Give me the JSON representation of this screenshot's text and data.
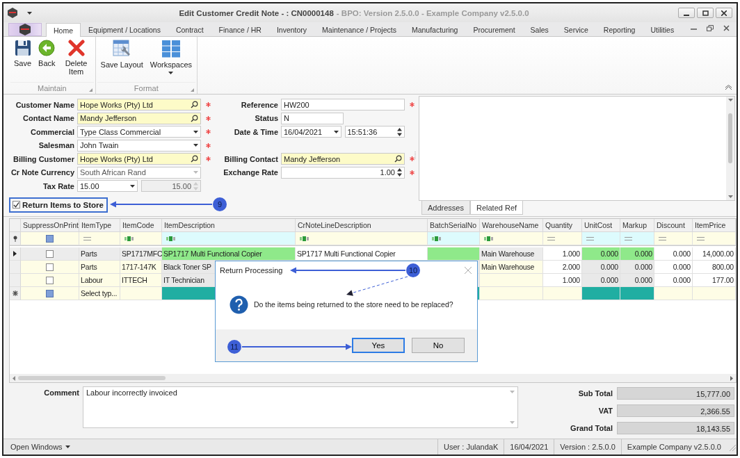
{
  "window": {
    "title": "Edit Customer Credit Note - : CN0000148",
    "subtitle": "- BPO: Version 2.5.0.0 - Example Company v2.5.0.0"
  },
  "ribbon": {
    "tabs": [
      {
        "label": "Home",
        "selected": true
      },
      {
        "label": "Equipment / Locations",
        "selected": false
      },
      {
        "label": "Contract",
        "selected": false
      },
      {
        "label": "Finance / HR",
        "selected": false
      },
      {
        "label": "Inventory",
        "selected": false
      },
      {
        "label": "Maintenance / Projects",
        "selected": false
      },
      {
        "label": "Manufacturing",
        "selected": false
      },
      {
        "label": "Procurement",
        "selected": false
      },
      {
        "label": "Sales",
        "selected": false
      },
      {
        "label": "Service",
        "selected": false
      },
      {
        "label": "Reporting",
        "selected": false
      },
      {
        "label": "Utilities",
        "selected": false
      }
    ],
    "groups": [
      {
        "label": "Maintain",
        "buttons": [
          {
            "label": "Save",
            "dropdown": false
          },
          {
            "label": "Back",
            "dropdown": false
          },
          {
            "label": "Delete Item",
            "dropdown": false
          }
        ]
      },
      {
        "label": "Format",
        "buttons": [
          {
            "label": "Save Layout",
            "dropdown": false
          },
          {
            "label": "Workspaces",
            "dropdown": true
          }
        ]
      }
    ]
  },
  "form": {
    "left": [
      {
        "label": "Customer Name",
        "required": true,
        "fields": [
          {
            "kind": "lookup",
            "value": "Hope Works (Pty) Ltd",
            "disabled": false
          }
        ]
      },
      {
        "label": "Contact Name",
        "required": true,
        "fields": [
          {
            "kind": "lookup",
            "value": "Mandy Jefferson",
            "disabled": false
          }
        ]
      },
      {
        "label": "Commercial",
        "required": true,
        "fields": [
          {
            "kind": "combo",
            "value": "Type Class Commercial",
            "disabled": false
          }
        ]
      },
      {
        "label": "Salesman",
        "required": true,
        "fields": [
          {
            "kind": "combo",
            "value": "John Twain",
            "disabled": false
          }
        ]
      },
      {
        "label": "Billing Customer",
        "required": true,
        "fields": [
          {
            "kind": "lookup",
            "value": "Hope Works (Pty) Ltd",
            "disabled": false
          }
        ]
      },
      {
        "label": "Cr Note Currency",
        "required": false,
        "fields": [
          {
            "kind": "combo",
            "value": "South African Rand",
            "disabled": true
          }
        ]
      },
      {
        "label": "Tax Rate",
        "required": false,
        "fields": [
          {
            "kind": "combo",
            "value": "15.00",
            "disabled": false
          },
          {
            "kind": "spin",
            "value": "15.00",
            "disabled": true
          }
        ]
      }
    ],
    "right_groups": [
      [
        {
          "label": "Reference",
          "required": true,
          "fields": [
            {
              "kind": "text",
              "value": "HW200",
              "disabled": false
            }
          ]
        },
        {
          "label": "Status",
          "required": false,
          "fields": [
            {
              "kind": "short_text",
              "value": "N",
              "disabled": false
            }
          ]
        },
        {
          "label": "Date & Time",
          "required": false,
          "fields": [
            {
              "kind": "date",
              "value": "16/04/2021",
              "disabled": false
            },
            {
              "kind": "time",
              "value": "15:51:36",
              "disabled": false
            }
          ]
        }
      ],
      [
        {
          "label": "Billing Contact",
          "required": true,
          "fields": [
            {
              "kind": "lookup",
              "value": "Mandy Jefferson",
              "disabled": false
            }
          ]
        },
        {
          "label": "Exchange Rate",
          "required": true,
          "fields": [
            {
              "kind": "spin",
              "value": "1.00",
              "disabled": false
            }
          ]
        }
      ]
    ],
    "return_items": {
      "label": "Return Items to Store",
      "checked": true
    }
  },
  "side_panel": {
    "tabs": [
      {
        "label": "Addresses",
        "selected": false
      },
      {
        "label": "Related Ref",
        "selected": true
      }
    ]
  },
  "grid": {
    "suppress_filter": {
      "checked": false,
      "indeterminate": true
    },
    "columns": [
      {
        "label": "SuppressOnPrint",
        "kind": "choice"
      },
      {
        "label": "ItemType",
        "kind": "choice"
      },
      {
        "label": "ItemCode",
        "kind": "choice"
      },
      {
        "label": "ItemDescription",
        "kind": "lookup"
      },
      {
        "label": "CrNoteLineDescription",
        "kind": "entry"
      },
      {
        "label": "BatchSerialNo",
        "kind": "lookup"
      },
      {
        "label": "WarehouseName",
        "kind": "choice"
      },
      {
        "label": "Quantity",
        "kind": "entry"
      },
      {
        "label": "UnitCost",
        "kind": "lookup"
      },
      {
        "label": "Markup",
        "kind": "lookup"
      },
      {
        "label": "Discount",
        "kind": "entry"
      },
      {
        "label": "ItemPrice",
        "kind": "entry"
      }
    ],
    "rows": [
      {
        "kind": "current",
        "cells": [
          {
            "checked": false,
            "indeterminate": false
          },
          "Parts",
          "SP1717MFC",
          "SP1717 Multi Functional Copier",
          "SP1717 Multi Functional Copier",
          null,
          "Main Warehouse",
          "1.000",
          "0.000",
          "0.000",
          "0.000",
          "14,000.00"
        ]
      },
      {
        "kind": "normal",
        "cells": [
          {
            "checked": false,
            "indeterminate": false
          },
          "Parts",
          "1717-147K",
          "Black Toner SP",
          null,
          null,
          "Main Warehouse",
          "2.000",
          "0.000",
          "0.000",
          "0.000",
          "800.00"
        ]
      },
      {
        "kind": "normal",
        "cells": [
          {
            "checked": false,
            "indeterminate": false
          },
          "Labour",
          "ITTECH",
          "IT Technician",
          null,
          null,
          null,
          "1.000",
          "0.000",
          "0.000",
          "0.000",
          "177.00"
        ]
      },
      {
        "kind": "new",
        "cells": [
          {
            "checked": false,
            "indeterminate": true
          },
          "Select typ...",
          null,
          null,
          null,
          null,
          null,
          null,
          null,
          null,
          null,
          null
        ]
      }
    ]
  },
  "comment": {
    "label": "Comment",
    "value": "Labour incorrectly invoiced"
  },
  "totals": [
    {
      "label": "Sub Total",
      "value": "15,777.00"
    },
    {
      "label": "VAT",
      "value": "2,366.55"
    },
    {
      "label": "Grand Total",
      "value": "18,143.55"
    }
  ],
  "status_bar": {
    "menu": "Open Windows",
    "items": [
      "User : JulandaK",
      "16/04/2021",
      "Version : 2.5.0.0",
      "Example Company v2.5.0.0"
    ]
  },
  "dialog": {
    "title": "Return Processing",
    "message": "Do the items being returned to the store need to be replaced?",
    "buttons": [
      {
        "label": "Yes",
        "selected": true
      },
      {
        "label": "No",
        "selected": false
      }
    ]
  },
  "callouts": [
    {
      "label": "9"
    },
    {
      "label": "10"
    },
    {
      "label": "11"
    }
  ]
}
